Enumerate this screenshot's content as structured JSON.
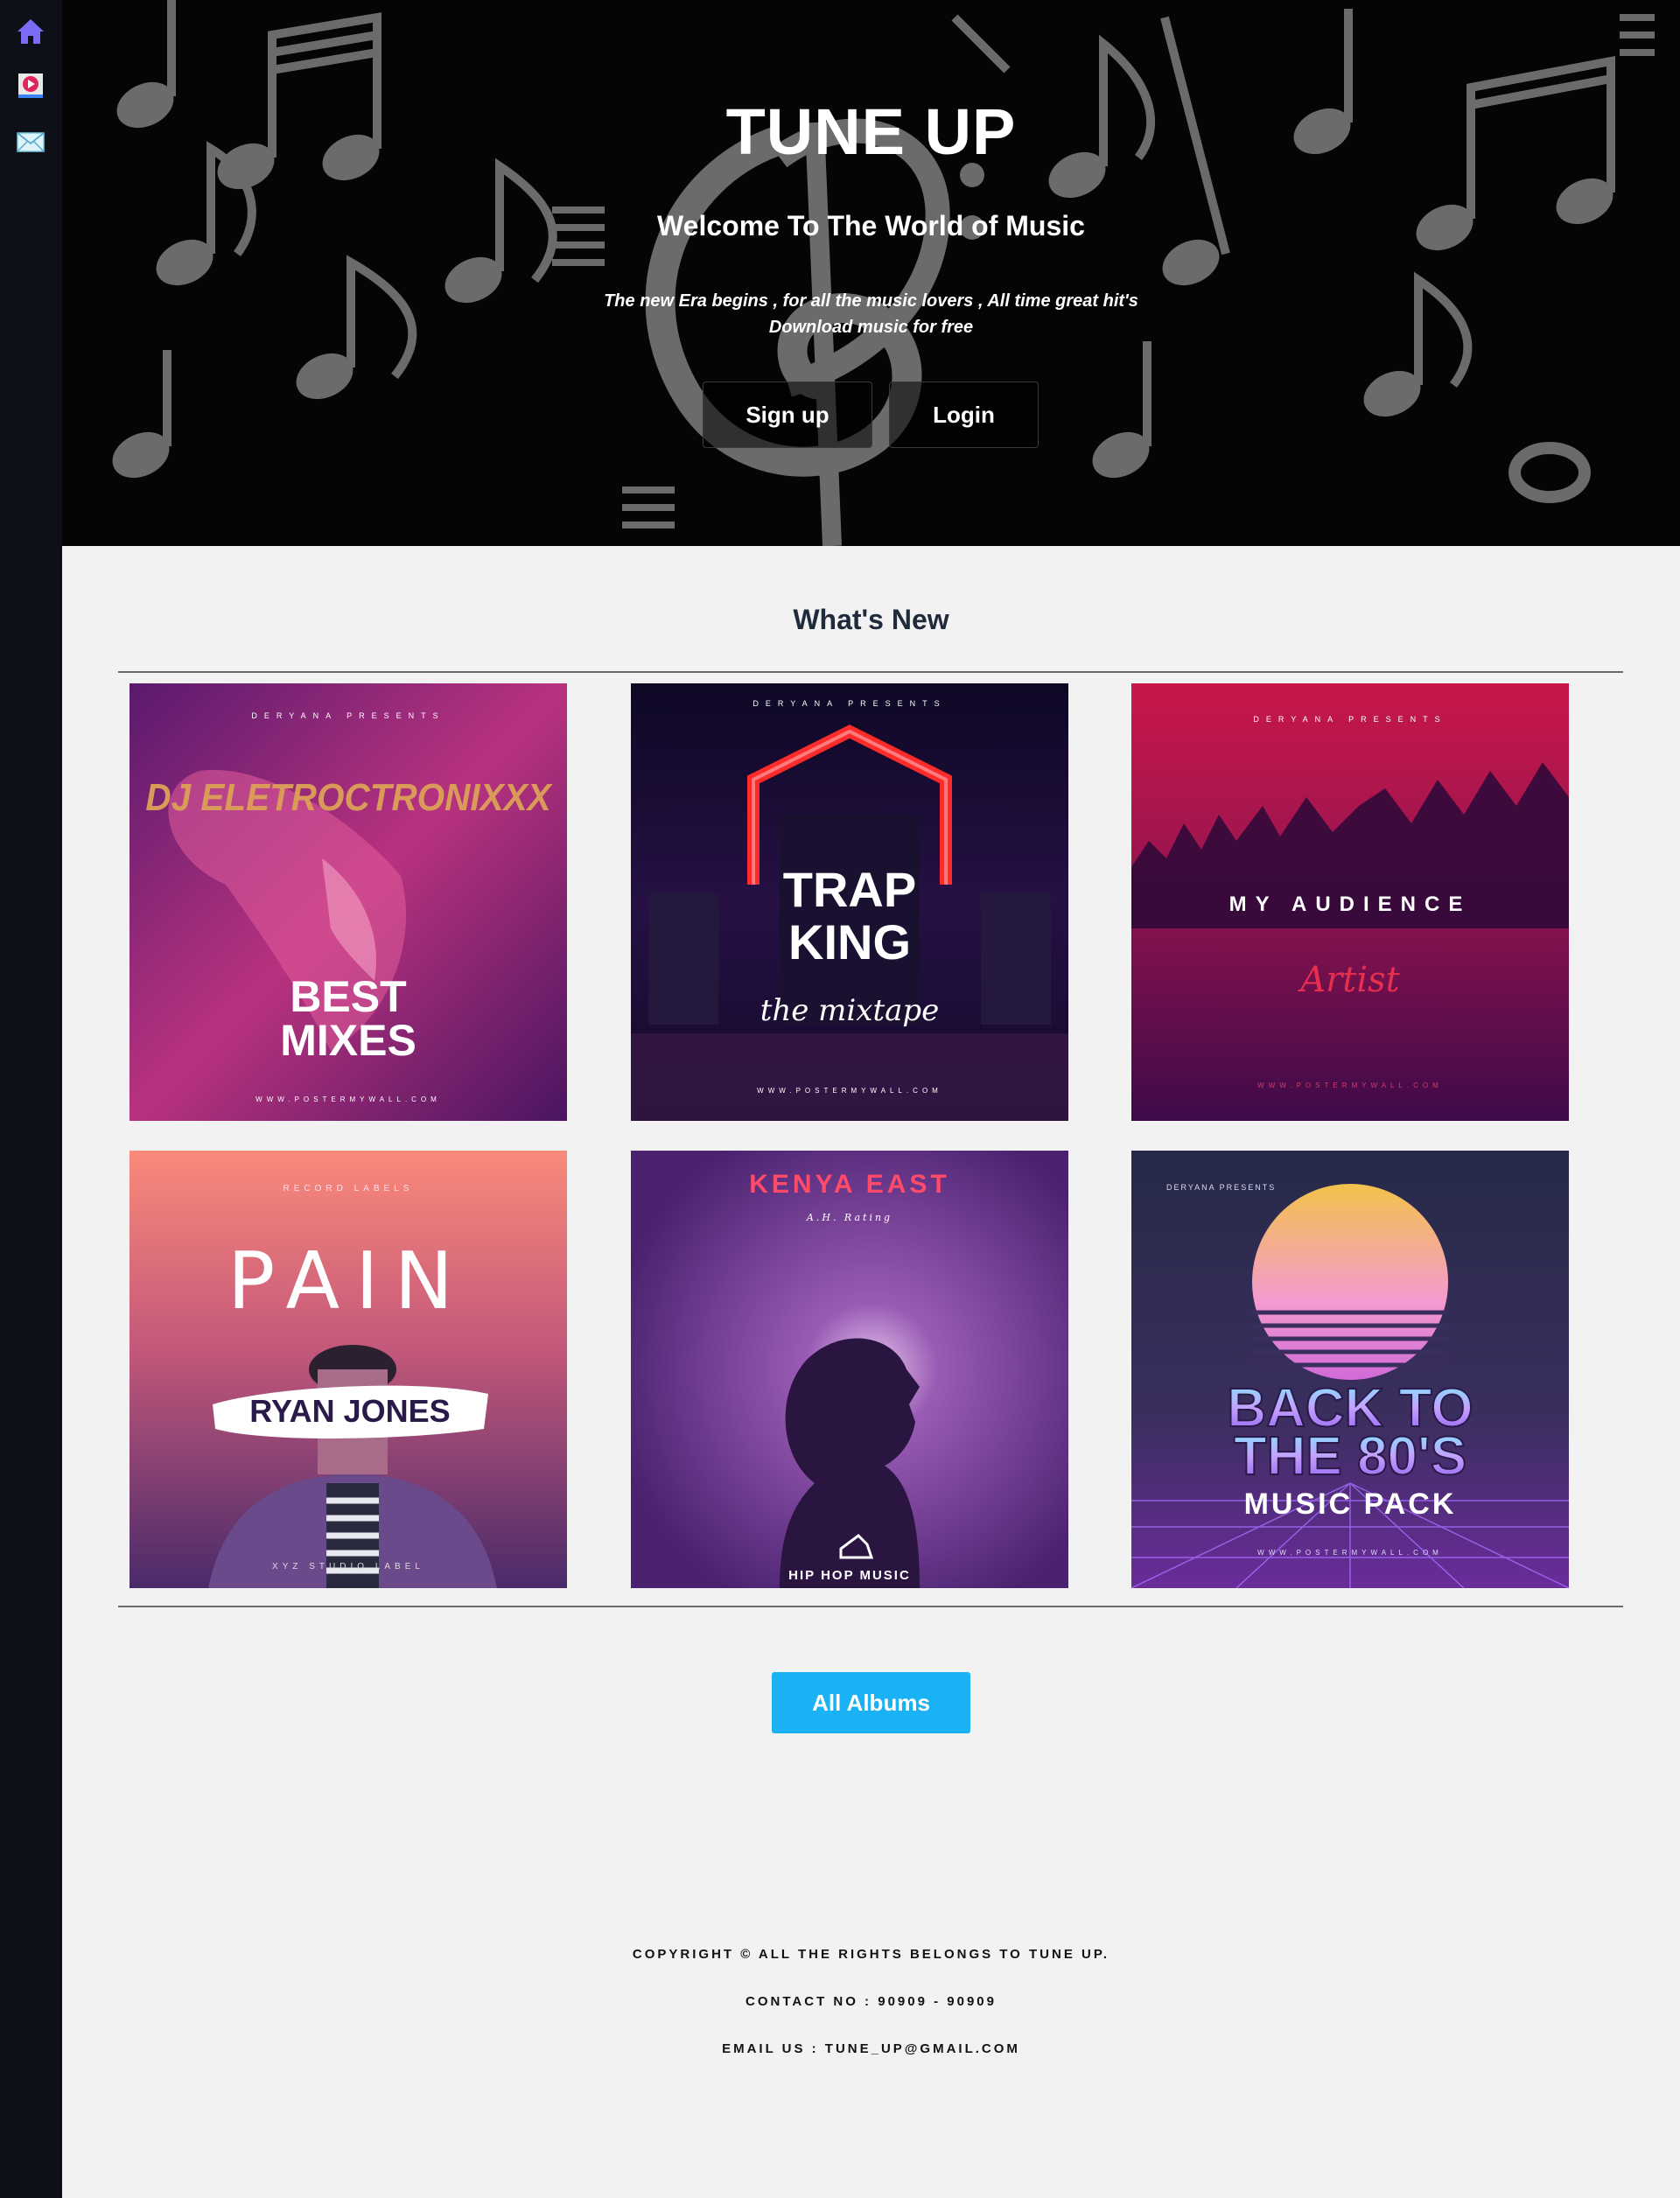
{
  "sidebar": {
    "items": [
      {
        "name": "home",
        "icon": "home-icon"
      },
      {
        "name": "videos",
        "icon": "play-icon"
      },
      {
        "name": "contact",
        "icon": "mail-icon"
      }
    ]
  },
  "hero": {
    "title": "TUNE UP",
    "subtitle": "Welcome To The World of Music",
    "tagline_1": "The new Era begins , for all the music lovers , All time great hit's",
    "tagline_2": "Download music for free",
    "signup_label": "Sign up",
    "login_label": "Login"
  },
  "whats_new": {
    "title": "What's New",
    "albums": [
      {
        "top_text": "DERYANA PRESENTS",
        "artist": "DJ ELETROCTRONIXXX",
        "title_1": "BEST",
        "title_2": "MIXES",
        "bottom_text": "WWW.POSTERMYWALL.COM"
      },
      {
        "top_text": "DERYANA PRESENTS",
        "title_1": "TRAP",
        "title_2": "KING",
        "subtitle": "the mixtape",
        "bottom_text": "WWW.POSTERMYWALL.COM"
      },
      {
        "top_text": "DERYANA PRESENTS",
        "title_1": "MY AUDIENCE",
        "subtitle": "Artist",
        "bottom_text": "WWW.POSTERMYWALL.COM"
      },
      {
        "top_text": "RECORD LABELS",
        "title_1": "PAIN",
        "artist": "RYAN JONES",
        "bottom_text": "XYZ STUDIO LABEL"
      },
      {
        "title_1": "KENYA EAST",
        "subtitle": "A.H. Rating",
        "bottom_text": "HIP HOP MUSIC"
      },
      {
        "top_text": "DERYANA PRESENTS",
        "title_1": "BACK TO",
        "title_2": "THE 80'S",
        "subtitle": "MUSIC PACK",
        "bottom_text": "WWW.POSTERMYWALL.COM"
      }
    ],
    "all_albums_label": "All Albums"
  },
  "footer": {
    "copyright": "COPYRIGHT © ALL THE RIGHTS BELONGS TO TUNE UP.",
    "contact": "CONTACT NO : 90909 - 90909",
    "email": "EMAIL US : TUNE_UP@GMAIL.COM"
  },
  "colors": {
    "sidebar_bg": "#0d1117",
    "hero_bg": "#050505",
    "page_bg": "#f2f2f2",
    "button_blue": "#1ab2f5",
    "home_icon": "#7b6cf6"
  }
}
